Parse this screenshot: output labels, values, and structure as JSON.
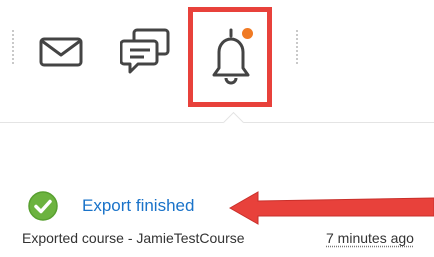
{
  "toolbar": {
    "icons": [
      "mail-icon",
      "chat-icon",
      "bell-icon"
    ],
    "badge_color": "#f07a24",
    "highlight_color": "#e8413b"
  },
  "notification": {
    "title": "Export finished",
    "description": "Exported course - JamieTestCourse",
    "time": "7 minutes ago",
    "status_icon": "check-circle-icon",
    "status_color": "#6cb33f",
    "title_color": "#1a73c9"
  },
  "annotation": {
    "arrow_color": "#e8413b"
  }
}
